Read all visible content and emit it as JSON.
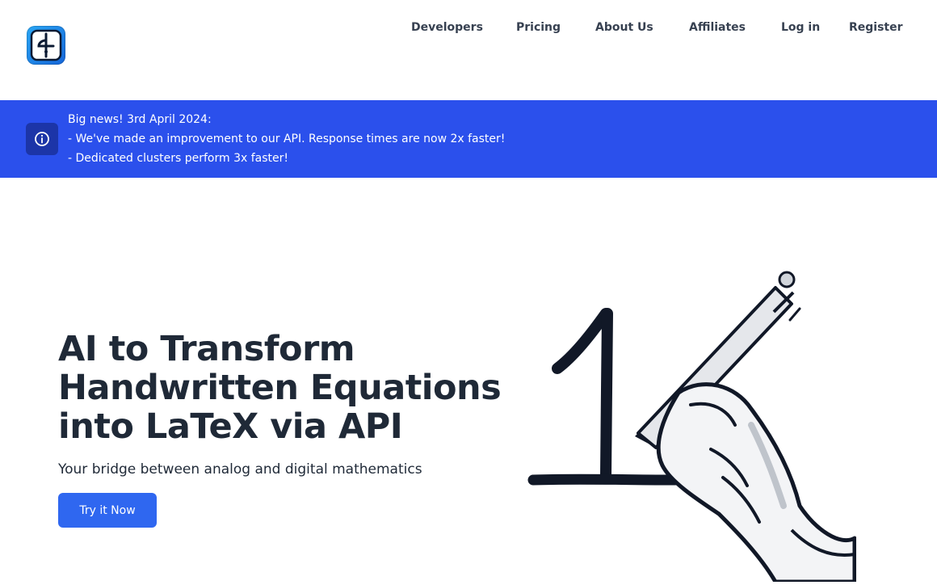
{
  "header": {
    "logo_icon": "pen-nib-logo-icon",
    "nav": [
      {
        "label": "Developers"
      },
      {
        "label": "Pricing"
      },
      {
        "label": "About Us"
      },
      {
        "label": "Affiliates"
      },
      {
        "label": "Log in"
      },
      {
        "label": "Register"
      }
    ]
  },
  "banner": {
    "icon": "info-icon",
    "lines": [
      "Big news! 3rd April 2024:",
      "- We've made an improvement to our API. Response times are now 2x faster!",
      "- Dedicated clusters perform 3x faster!"
    ],
    "color": "#2b50ec"
  },
  "hero": {
    "title_lines": [
      "AI to Transform",
      "Handwritten Equations",
      "into LaTeX via API"
    ],
    "subtitle": "Your bridge between analog and digital mathematics",
    "cta_label": "Try it Now",
    "cta_color": "#2f67f0",
    "illustration": "hand-writing-number-one-illustration"
  }
}
